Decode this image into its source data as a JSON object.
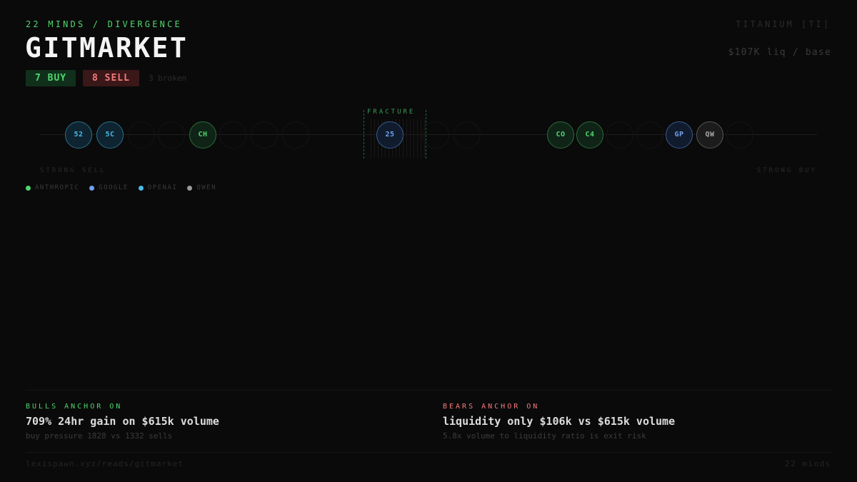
{
  "header": {
    "kicker": "22 MINDS / DIVERGENCE",
    "title": "GITMARKET",
    "asset": "TITANIUM [TI]",
    "liquidity": "$107K liq / base"
  },
  "verdict": {
    "buy_label": "7 BUY",
    "sell_label": "8 SELL",
    "broken_label": "3 broken"
  },
  "spectrum": {
    "fracture_label": "FRACTURE",
    "left_end": "STRONG SELL",
    "right_end": "STRONG BUY",
    "nodes": [
      {
        "label": "52",
        "provider": "openai"
      },
      {
        "label": "5C",
        "provider": "openai"
      },
      {
        "label": "CH",
        "provider": "anthropic"
      },
      {
        "label": "25",
        "provider": "google"
      },
      {
        "label": "CO",
        "provider": "anthropic"
      },
      {
        "label": "C4",
        "provider": "anthropic"
      },
      {
        "label": "GP",
        "provider": "google"
      },
      {
        "label": "QW",
        "provider": "qwen"
      }
    ]
  },
  "legend": [
    {
      "label": "ANTHROPIC",
      "color": "#4fd66e"
    },
    {
      "label": "GOOGLE",
      "color": "#6fa0ee"
    },
    {
      "label": "OPENAI",
      "color": "#4ab9e8"
    },
    {
      "label": "QWEN",
      "color": "#9a9a9a"
    }
  ],
  "bulls": {
    "label": "BULLS ANCHOR ON",
    "claim": "709% 24hr gain on $615k volume",
    "detail": "buy pressure 1828 vs 1332 sells"
  },
  "bears": {
    "label": "BEARS ANCHOR ON",
    "claim": "liquidity only $106k vs $615k volume",
    "detail": "5.8x volume to liquidity ratio is exit risk"
  },
  "footer": {
    "url": "lexispawn.xyz/reads/gitmarket",
    "count": "22 minds"
  }
}
